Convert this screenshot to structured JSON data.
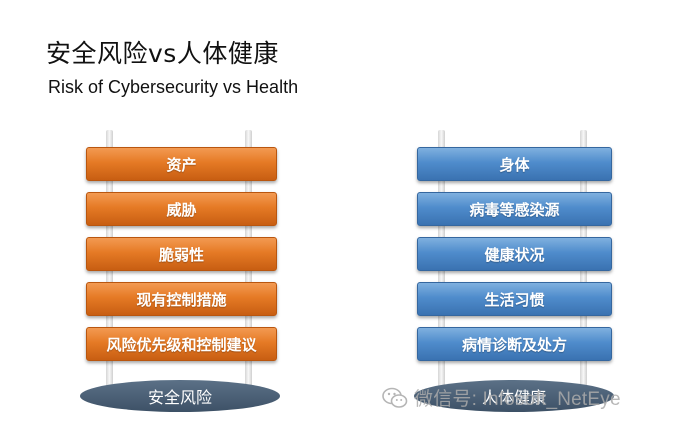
{
  "title": "安全风险vs人体健康",
  "subtitle": "Risk of Cybersecurity vs Health",
  "left": {
    "items": [
      "资产",
      "威胁",
      "脆弱性",
      "现有控制措施",
      "风险优先级和控制建议"
    ],
    "base": "安全风险"
  },
  "right": {
    "items": [
      "身体",
      "病毒等感染源",
      "健康状况",
      "生活习惯",
      "病情诊断及处方"
    ],
    "base": "人体健康"
  },
  "watermark": "微信号: Infosoft_NetEye",
  "colors": {
    "left_bar": "#e57a25",
    "right_bar": "#4f8ccc",
    "base": "#46596d"
  }
}
